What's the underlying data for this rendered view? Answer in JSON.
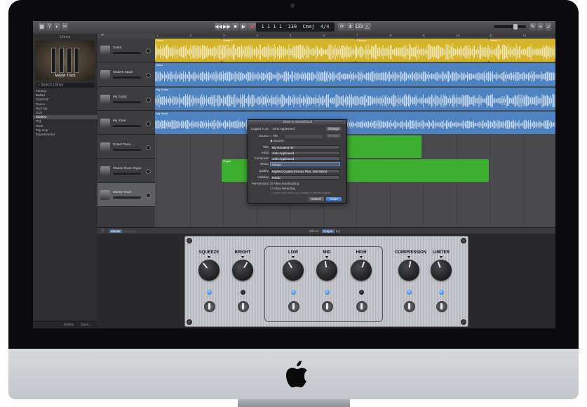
{
  "app": {
    "lcd": {
      "bar": "1",
      "beat": "1",
      "division": "1",
      "tick": "1",
      "tempo": "130",
      "key": "Cmaj",
      "time_signature": "4/4"
    },
    "toolbar_buttons": [
      "library",
      "help",
      "smart-controls",
      "editors",
      "rewind",
      "fast-forward",
      "stop",
      "play",
      "record",
      "cycle",
      "tuner",
      "count-in",
      "metronome",
      "notepad",
      "loop-browser",
      "media-browser"
    ]
  },
  "library": {
    "title": "Library",
    "preset_name": "Master Track",
    "search_placeholder": "Search Library",
    "items": [
      "Factory",
      "Ballad",
      "Classical",
      "Dance",
      "Hip Hop",
      "Jazz",
      "Modern",
      "Pop",
      "Rock",
      "Trip Hop",
      "Experimental"
    ],
    "selected_index": 6,
    "footer": {
      "delete_label": "Delete",
      "save_label": "Save..."
    }
  },
  "tracks": [
    {
      "name": "Guitar",
      "color": "#d4b52a"
    },
    {
      "name": "Modern Stack",
      "color": "#4e83c2"
    },
    {
      "name": "My Guitar",
      "color": "#4e83c2"
    },
    {
      "name": "My Vocal",
      "color": "#4e83c2"
    },
    {
      "name": "Grand Piano",
      "color": "#3db032"
    },
    {
      "name": "Classic Rock Organ",
      "color": "#3db032"
    },
    {
      "name": "Master Track",
      "color": "#5e5f63",
      "selected": true
    }
  ],
  "ruler": [
    "1",
    "2",
    "3",
    "4",
    "5",
    "6",
    "7",
    "8",
    "9",
    "10",
    "11",
    "12"
  ],
  "regions": {
    "drums": [
      "Verse",
      "Verse 2",
      "Chorus",
      "Verse 3"
    ],
    "bass": "Bass",
    "guitar": "My Guitar",
    "vocal": "My Vocal",
    "organ": "Organ"
  },
  "share_dialog": {
    "title": "Share to SoundCloud",
    "logged_in_label": "Logged in as:",
    "logged_in_value": "\"John Appleseed\"",
    "change_label": "Change",
    "source_label": "Source:",
    "source_file": "File",
    "source_bounce": "Bounce",
    "browse_label": "Browse",
    "title_label": "Title:",
    "title_value": "My Greatest Hit",
    "artist_label": "Artist:",
    "artist_value": "John Appleseed",
    "composer_label": "Composer:",
    "composer_value": "John Appleseed",
    "album_label": "Album:",
    "album_value": "Songs",
    "quality_label": "Quality:",
    "quality_value": "Highest Quality (iTunes Plus, 256 kBit/s)",
    "visibility_label": "Visibility:",
    "visibility_value": "Public",
    "permissions_label": "Permissions:",
    "allow_downloading": "Allow downloading",
    "allow_streaming": "Allow streaming",
    "export_cycle": "Export cycle area only, or length of selected regions",
    "cancel_label": "Cancel",
    "share_label": "Share"
  },
  "smart_controls": {
    "tabs": {
      "master": "Master",
      "compare": "Compare",
      "effects": "Effects",
      "output": "Output",
      "eq": "EQ"
    },
    "knobs": [
      {
        "label": "SQUEEZE",
        "led": true
      },
      {
        "label": "BRIGHT",
        "led": false
      },
      {
        "label": "LOW",
        "led": true
      },
      {
        "label": "MID",
        "led": true
      },
      {
        "label": "HIGH",
        "led": false
      },
      {
        "label": "COMPRESSION",
        "led": true
      },
      {
        "label": "LIMITER",
        "led": true
      }
    ]
  },
  "colors": {
    "drum_region": "#d4b52a",
    "audio_region": "#4e83c2",
    "midi_region": "#3db032",
    "led_on": "#2d7ae6"
  }
}
